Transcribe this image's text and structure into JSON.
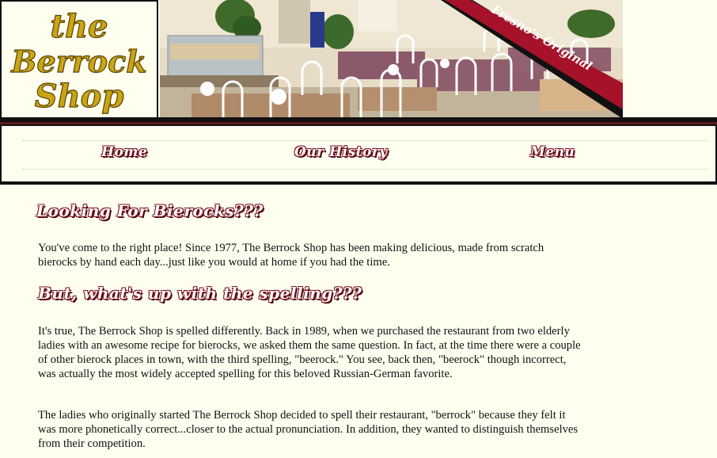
{
  "header": {
    "logo_lines": [
      "the",
      "Berrock",
      "Shop"
    ],
    "banner_text": "Fresno's Original"
  },
  "nav": {
    "items": [
      {
        "label": "Home"
      },
      {
        "label": "Our History"
      },
      {
        "label": "Menu"
      }
    ]
  },
  "content": {
    "heading1": "Looking For Bierocks???",
    "para1": "You've come to the right place! Since 1977, The Berrock Shop has been making delicious, made from scratch bierocks by hand each day...just like you would at home if you had the time.",
    "heading2": "But, what's up with the spelling???",
    "para2": "It's true, The Berrock Shop is spelled differently. Back in 1989, when we purchased the restaurant from two elderly ladies with an awesome recipe for bierocks, we asked them the same question. In fact, at the time there were a couple of other bierock places in town, with the third spelling, \"beerock.\" You see, back then, \"beerock\" though incorrect, was actually the most widely accepted spelling for this beloved Russian-German favorite.",
    "para3": "The ladies who originally started The Berrock Shop decided to spell their restaurant, \"berrock\" because they felt it was more phonetically correct...closer to the actual pronunciation. In addition, they wanted to distinguish themselves from their competition."
  },
  "colors": {
    "background": "#fffff0",
    "logo_gold": "#c9a516",
    "accent_maroon": "#7a1020",
    "border": "#111111"
  }
}
